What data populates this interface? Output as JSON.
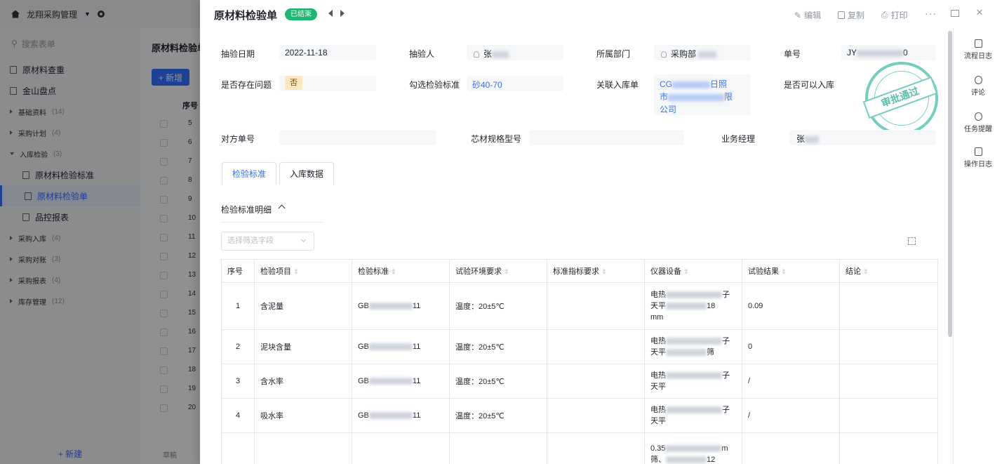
{
  "app": {
    "name": "龙翔采购管理",
    "sidebar": {
      "search_placeholder": "搜索表单",
      "items": [
        {
          "label": "原材料查重",
          "type": "page"
        },
        {
          "label": "金山盘点",
          "type": "page"
        },
        {
          "label": "基础资料",
          "count": "(14)",
          "type": "group"
        },
        {
          "label": "采购计划",
          "count": "(4)",
          "type": "group"
        },
        {
          "label": "入库检验",
          "count": "(3)",
          "type": "group-open"
        },
        {
          "label": "原材料检验标准",
          "type": "sub"
        },
        {
          "label": "原材料检验单",
          "type": "sub-active"
        },
        {
          "label": "品控报表",
          "type": "sub"
        },
        {
          "label": "采购入库",
          "count": "(4)",
          "type": "group"
        },
        {
          "label": "采购对账",
          "count": "(3)",
          "type": "group"
        },
        {
          "label": "采购报表",
          "count": "(4)",
          "type": "group"
        },
        {
          "label": "库存管理",
          "count": "(12)",
          "type": "group"
        }
      ],
      "new_label": "+ 新建"
    },
    "main": {
      "title": "原材料检验单",
      "add_label": "+ 新增",
      "col_index": "序号",
      "row_numbers": [
        "5",
        "6",
        "7",
        "8",
        "9",
        "10",
        "11",
        "12",
        "13",
        "14",
        "15",
        "16",
        "17",
        "18",
        "19",
        "20"
      ],
      "draft_label": "草稿"
    }
  },
  "drawer": {
    "title": "原材料检验单",
    "status": "已结束",
    "actions": {
      "edit": "编辑",
      "copy": "复制",
      "print": "打印"
    },
    "more": "···",
    "rail": [
      {
        "label": "流程日志",
        "icon": "flow-log-icon"
      },
      {
        "label": "评论",
        "icon": "comment-icon"
      },
      {
        "label": "任务提醒",
        "icon": "bell-icon"
      },
      {
        "label": "操作日志",
        "icon": "operation-log-icon"
      }
    ],
    "form": {
      "sample_date_label": "抽验日期",
      "sample_date": "2022-11-18",
      "inspector_label": "抽验人",
      "inspector": "张",
      "department_label": "所属部门",
      "department": "采购部",
      "order_no_label": "单号",
      "order_no_prefix": "JY",
      "order_no_suffix": "0",
      "problem_label": "是否存在问题",
      "problem": "否",
      "standard_label": "勾选检验标准",
      "standard": "砂40-70",
      "related_label": "关联入库单",
      "related_line1": "CG",
      "related_line1_end": "日照",
      "related_line2": "市",
      "related_line2_end": "限",
      "related_line3": "公司",
      "can_stock_label": "是否可以入库",
      "counterpart_label": "对方单号",
      "spec_label": "芯材规格型号",
      "manager_label": "业务经理",
      "manager": "张"
    },
    "stamp_text": "审批通过",
    "tabs": [
      {
        "label": "检验标准",
        "active": true
      },
      {
        "label": "入库数据",
        "active": false
      }
    ],
    "section_title": "检验标准明细",
    "filter_placeholder": "选择筛选字段",
    "table": {
      "columns": [
        "序号",
        "检验项目",
        "检验标准",
        "试验环境要求",
        "标准指标要求",
        "仪器设备",
        "试验结果",
        "结论"
      ],
      "rows": [
        {
          "no": "1",
          "item": "含泥量",
          "std_pre": "GB",
          "std_post": "11",
          "env": "温度：20±5℃",
          "req": "",
          "ins": [
            "电热",
            "子",
            "天平",
            "18",
            "mm"
          ],
          "result": "0.09",
          "conclusion": ""
        },
        {
          "no": "2",
          "item": "泥块含量",
          "std_pre": "GB",
          "std_post": "11",
          "env": "温度：20±5℃",
          "req": "",
          "ins": [
            "电热",
            "子",
            "天平",
            "筛"
          ],
          "result": "0",
          "conclusion": ""
        },
        {
          "no": "3",
          "item": "含水率",
          "std_pre": "GB",
          "std_post": "11",
          "env": "温度：20±5℃",
          "req": "",
          "ins": [
            "电热",
            "子",
            "天平"
          ],
          "result": "/",
          "conclusion": ""
        },
        {
          "no": "4",
          "item": "吸水率",
          "std_pre": "GB",
          "std_post": "11",
          "env": "温度：20±5℃",
          "req": "",
          "ins": [
            "电热",
            "子",
            "天平"
          ],
          "result": "/",
          "conclusion": ""
        },
        {
          "no": "",
          "item": "",
          "std_pre": "",
          "std_post": "",
          "env": "",
          "req": "",
          "ins": [
            "0.35",
            "m",
            "筛、",
            "12"
          ],
          "result": "",
          "conclusion": ""
        }
      ]
    }
  },
  "colors": {
    "primary": "#3370ff",
    "status_green": "#1fb573",
    "stamp": "#5cc6b5",
    "tag_orange": "#fde6c2"
  }
}
